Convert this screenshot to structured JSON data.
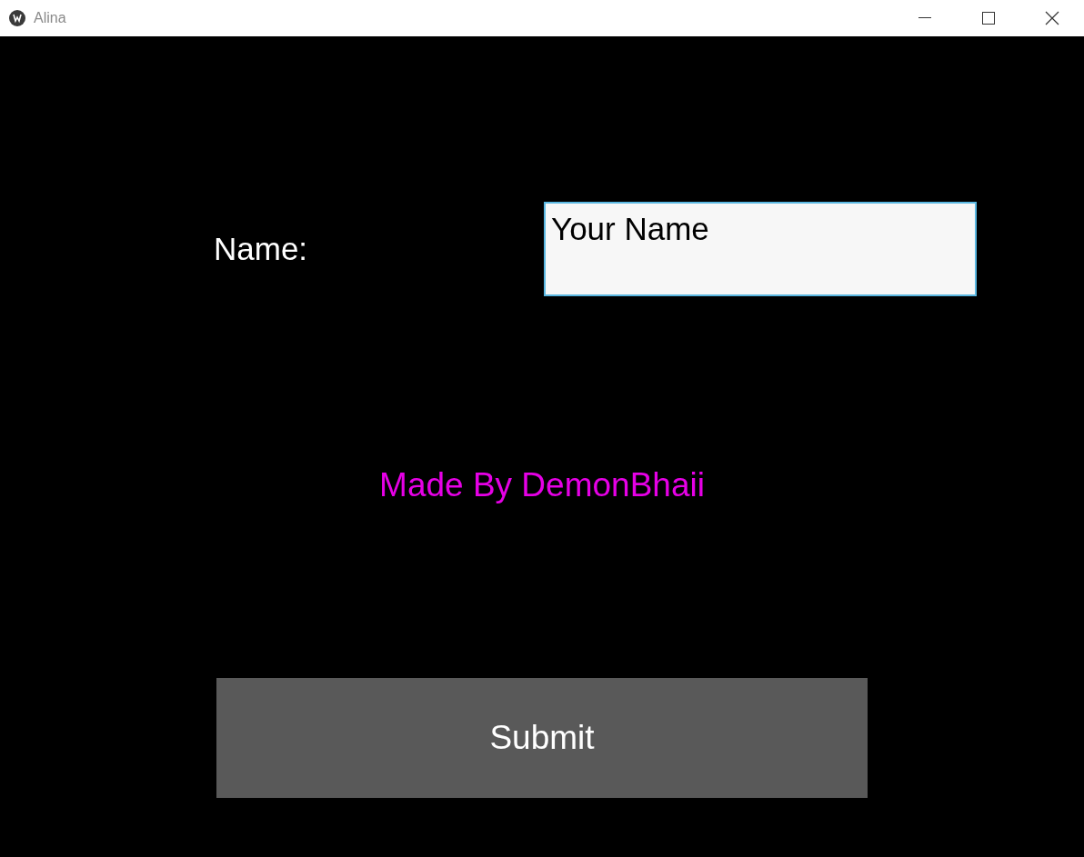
{
  "window": {
    "title": "Alina"
  },
  "form": {
    "label": "Name:",
    "field": {
      "value": "Your Name",
      "focused": true
    }
  },
  "credit": "Made By DemonBhaii",
  "buttons": [
    "Submit"
  ]
}
